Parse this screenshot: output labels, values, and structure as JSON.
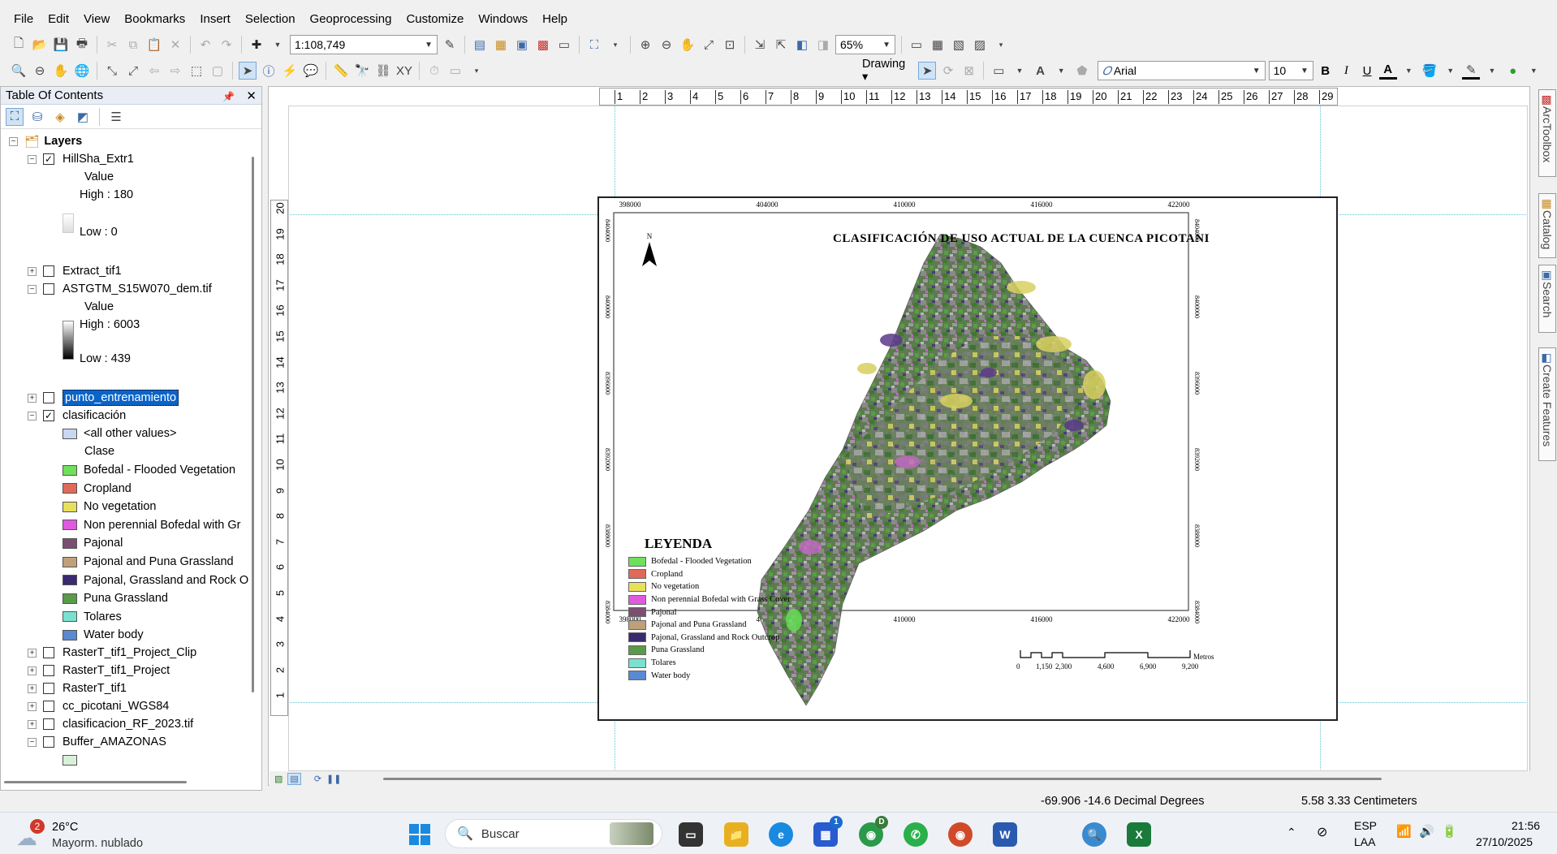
{
  "menu": [
    "File",
    "Edit",
    "View",
    "Bookmarks",
    "Insert",
    "Selection",
    "Geoprocessing",
    "Customize",
    "Windows",
    "Help"
  ],
  "toolbar": {
    "scale_value": "1:108,749",
    "zoom_value": "65%",
    "drawing_label": "Drawing",
    "font_name": "Arial",
    "font_size": "10",
    "bold_label": "B",
    "italic_label": "I",
    "underline_label": "U"
  },
  "toc": {
    "title": "Table Of Contents",
    "pin_glyph": "✚",
    "close_glyph": "✕",
    "layers_label": "Layers",
    "items": [
      {
        "label": "HillSha_Extr1",
        "checked": true,
        "expanded": true
      },
      {
        "label": "Value"
      },
      {
        "label": "High : 180"
      },
      {
        "label": "Low : 0"
      },
      {
        "label": "Extract_tif1",
        "checked": false,
        "expanded": false
      },
      {
        "label": "ASTGTM_S15W070_dem.tif",
        "checked": false,
        "expanded": true
      },
      {
        "label": "Value"
      },
      {
        "label": "High : 6003"
      },
      {
        "label": "Low : 439"
      },
      {
        "label": "punto_entrenamiento",
        "checked": false,
        "expanded": false,
        "selected": true
      },
      {
        "label": "clasificación",
        "checked": true,
        "expanded": true
      },
      {
        "label": "<all other values>"
      },
      {
        "label": "Clase"
      },
      {
        "label": "RasterT_tif1_Project_Clip",
        "checked": false,
        "expanded": false
      },
      {
        "label": "RasterT_tif1_Project",
        "checked": false,
        "expanded": false
      },
      {
        "label": "RasterT_tif1",
        "checked": false,
        "expanded": false
      },
      {
        "label": "cc_picotani_WGS84",
        "checked": false,
        "expanded": false
      },
      {
        "label": "clasificacion_RF_2023.tif",
        "checked": false,
        "expanded": false
      },
      {
        "label": "Buffer_AMAZONAS",
        "checked": false,
        "expanded": true
      }
    ],
    "classes": [
      {
        "label": "Bofedal - Flooded Vegetation",
        "color": "#6ee05a"
      },
      {
        "label": "Cropland",
        "color": "#e06a5a"
      },
      {
        "label": "No vegetation",
        "color": "#e8e05a"
      },
      {
        "label": "Non perennial Bofedal with Gr",
        "color": "#e05ae0"
      },
      {
        "label": "Pajonal",
        "color": "#7a5070"
      },
      {
        "label": "Pajonal and Puna Grassland",
        "color": "#c0a07a"
      },
      {
        "label": "Pajonal, Grassland and Rock O",
        "color": "#3a2a70"
      },
      {
        "label": "Puna Grassland",
        "color": "#5a9a4a"
      },
      {
        "label": "Tolares",
        "color": "#7ae0d0"
      },
      {
        "label": "Water body",
        "color": "#5a8ad0"
      }
    ]
  },
  "ruler_top": [
    "1",
    "2",
    "3",
    "4",
    "5",
    "6",
    "7",
    "8",
    "9",
    "10",
    "11",
    "12",
    "13",
    "14",
    "15",
    "16",
    "17",
    "18",
    "19",
    "20",
    "21",
    "22",
    "23",
    "24",
    "25",
    "26",
    "27",
    "28",
    "29"
  ],
  "ruler_left": [
    "20",
    "19",
    "18",
    "17",
    "16",
    "15",
    "14",
    "13",
    "12",
    "11",
    "10",
    "9",
    "8",
    "7",
    "6",
    "5",
    "4",
    "3",
    "2",
    "1"
  ],
  "map": {
    "title": "CLASIFICACIÓN DE USO ACTUAL DE LA CUENCA PICOTANI",
    "north_label": "N",
    "x_ticks": [
      "398000",
      "404000",
      "410000",
      "416000",
      "422000"
    ],
    "y_ticks": [
      "8404000",
      "8400000",
      "8396000",
      "8392000",
      "8388000",
      "8384000"
    ],
    "legend_title": "LEYENDA",
    "legend": [
      {
        "label": "Bofedal - Flooded Vegetation",
        "color": "#6ee05a"
      },
      {
        "label": "Cropland",
        "color": "#e06a5a"
      },
      {
        "label": "No vegetation",
        "color": "#e8e05a"
      },
      {
        "label": "Non perennial Bofedal with Grass Cover",
        "color": "#e05ae0"
      },
      {
        "label": "Pajonal",
        "color": "#7a5070"
      },
      {
        "label": "Pajonal and Puna Grassland",
        "color": "#c0a07a"
      },
      {
        "label": "Pajonal, Grassland and Rock Outcrop",
        "color": "#3a2a70"
      },
      {
        "label": "Puna Grassland",
        "color": "#5a9a4a"
      },
      {
        "label": "Tolares",
        "color": "#7ae0d0"
      },
      {
        "label": "Water body",
        "color": "#5a8ad0"
      }
    ],
    "scale_labels": [
      "0",
      "1,150",
      "2,300",
      "4,600",
      "6,900",
      "9,200"
    ],
    "scale_unit": "Metros"
  },
  "side_tabs": [
    "ArcToolbox",
    "Catalog",
    "Search",
    "Create Features"
  ],
  "status": {
    "coords": "-69.906  -14.6 Decimal Degrees",
    "page_coords": "5.58  3.33 Centimeters"
  },
  "taskbar": {
    "weather_temp": "26°C",
    "weather_desc": "Mayorm. nublado",
    "weather_badge": "2",
    "search_placeholder": "Buscar",
    "lang1": "ESP",
    "lang2": "LAA",
    "time": "21:56",
    "date": "27/10/2025",
    "badge_store": "1",
    "badge_chrome": "D"
  }
}
